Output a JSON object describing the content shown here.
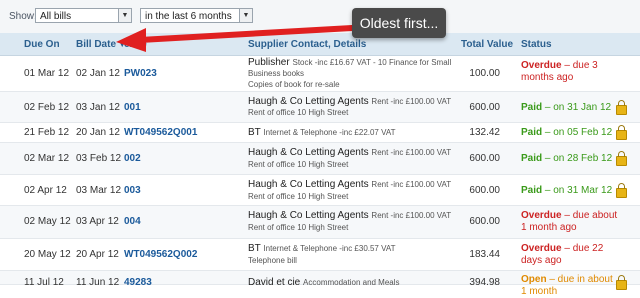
{
  "filters": {
    "show_label": "Show:",
    "bills_select": "All bills",
    "period_select": "in the last 6 months"
  },
  "annotation": {
    "callout_text": "Oldest first..."
  },
  "table": {
    "columns": {
      "due_on": "Due On",
      "bill_date": "Bill Date",
      "reference": "ence",
      "supplier": "Supplier Contact, Details",
      "total": "Total Value",
      "status": "Status"
    },
    "rows": [
      {
        "due": "01 Mar 12",
        "bill": "02 Jan 12",
        "ref": "PW023",
        "supplier": "Publisher",
        "extra": "Stock -inc £16.67 VAT - 10 Finance for Small",
        "line2": "Business books",
        "line3": "Copies of book for re-sale",
        "total": "100.00",
        "status_word": "Overdue",
        "status_rest": " – due 3 months ago",
        "status_kind": "overdue",
        "locked": false
      },
      {
        "due": "02 Feb 12",
        "bill": "03 Jan 12",
        "ref": "001",
        "supplier": "Haugh & Co Letting Agents",
        "extra": "Rent -inc £100.00 VAT",
        "line2": "Rent of office 10 High Street",
        "line3": "",
        "total": "600.00",
        "status_word": "Paid",
        "status_rest": " – on 31 Jan 12",
        "status_kind": "paid",
        "locked": true
      },
      {
        "due": "21 Feb 12",
        "bill": "20 Jan 12",
        "ref": "WT049562Q001",
        "supplier": "BT",
        "extra": "Internet & Telephone -inc £22.07 VAT",
        "line2": "",
        "line3": "",
        "total": "132.42",
        "status_word": "Paid",
        "status_rest": " – on 05 Feb 12",
        "status_kind": "paid",
        "locked": true
      },
      {
        "due": "02 Mar 12",
        "bill": "03 Feb 12",
        "ref": "002",
        "supplier": "Haugh & Co Letting Agents",
        "extra": "Rent -inc £100.00 VAT",
        "line2": "Rent of office 10 High Street",
        "line3": "",
        "total": "600.00",
        "status_word": "Paid",
        "status_rest": " – on 28 Feb 12",
        "status_kind": "paid",
        "locked": true
      },
      {
        "due": "02 Apr 12",
        "bill": "03 Mar 12",
        "ref": "003",
        "supplier": "Haugh & Co Letting Agents",
        "extra": "Rent -inc £100.00 VAT",
        "line2": "Rent of office 10 High Street",
        "line3": "",
        "total": "600.00",
        "status_word": "Paid",
        "status_rest": " – on 31 Mar 12",
        "status_kind": "paid",
        "locked": true
      },
      {
        "due": "02 May 12",
        "bill": "03 Apr 12",
        "ref": "004",
        "supplier": "Haugh & Co Letting Agents",
        "extra": "Rent -inc £100.00 VAT",
        "line2": "Rent of office 10 High Street",
        "line3": "",
        "total": "600.00",
        "status_word": "Overdue",
        "status_rest": " – due about 1 month ago",
        "status_kind": "overdue",
        "locked": false
      },
      {
        "due": "20 May 12",
        "bill": "20 Apr 12",
        "ref": "WT049562Q002",
        "supplier": "BT",
        "extra": "Internet & Telephone -inc £30.57 VAT",
        "line2": "Telephone bill",
        "line3": "",
        "total": "183.44",
        "status_word": "Overdue",
        "status_rest": " – due 22 days ago",
        "status_kind": "overdue",
        "locked": false
      },
      {
        "due": "11 Jul 12",
        "bill": "11 Jun 12",
        "ref": "49283",
        "supplier": "David et cie",
        "extra": "Accommodation and Meals",
        "line2": "",
        "line3": "",
        "total": "394.98",
        "status_word": "Open",
        "status_rest": " – due in about 1 month",
        "status_kind": "open",
        "locked": true
      }
    ]
  },
  "colors": {
    "overdue": "#cc2222",
    "paid": "#3a9a1a",
    "open": "#e08a00",
    "arrow": "#e02020",
    "header_bg": "#dbe8f2"
  },
  "icons": {
    "sort": "sort-down-icon",
    "lock": "lock-icon"
  }
}
